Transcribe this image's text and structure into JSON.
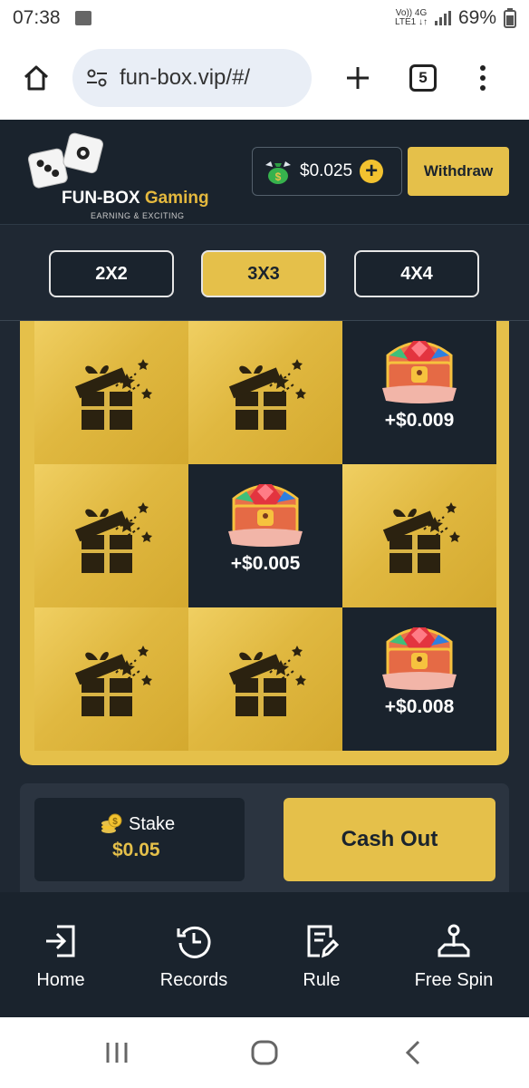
{
  "status_bar": {
    "time": "07:38",
    "network_line1": "Vo)) 4G",
    "network_line2": "LTE1 ↓↑",
    "battery": "69%"
  },
  "browser": {
    "url": "fun-box.vip/#/",
    "tab_count": "5"
  },
  "header": {
    "logo_name_white": "FUN-BOX",
    "logo_name_gold": " Gaming",
    "logo_tagline": "EARNING & EXCITING",
    "balance": "$0.025",
    "withdraw_label": "Withdraw"
  },
  "size_tabs": [
    {
      "label": "2X2",
      "active": false
    },
    {
      "label": "3X3",
      "active": true
    },
    {
      "label": "4X4",
      "active": false
    }
  ],
  "board": {
    "cells": [
      {
        "state": "gift",
        "reward": ""
      },
      {
        "state": "gift",
        "reward": ""
      },
      {
        "state": "revealed",
        "reward": "+$0.009"
      },
      {
        "state": "gift",
        "reward": ""
      },
      {
        "state": "revealed",
        "reward": "+$0.005"
      },
      {
        "state": "gift",
        "reward": ""
      },
      {
        "state": "gift",
        "reward": ""
      },
      {
        "state": "gift",
        "reward": ""
      },
      {
        "state": "revealed",
        "reward": "+$0.008"
      }
    ]
  },
  "stake": {
    "label": "Stake",
    "value": "$0.05"
  },
  "cashout_label": "Cash Out",
  "nav": [
    {
      "label": "Home",
      "icon": "login-icon"
    },
    {
      "label": "Records",
      "icon": "history-icon"
    },
    {
      "label": "Rule",
      "icon": "document-edit-icon"
    },
    {
      "label": "Free Spin",
      "icon": "joystick-icon"
    }
  ],
  "colors": {
    "accent": "#e5c04a",
    "dark": "#1a232d",
    "panel": "#2b3440"
  }
}
